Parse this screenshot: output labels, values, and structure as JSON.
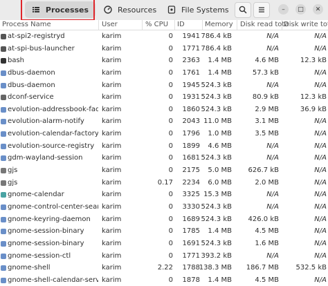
{
  "tabs": [
    {
      "label": "Processes",
      "icon": "list-icon"
    },
    {
      "label": "Resources",
      "icon": "gauge-icon"
    },
    {
      "label": "File Systems",
      "icon": "disk-icon"
    }
  ],
  "header_buttons": {
    "search_icon": "search-icon",
    "menu_icon": "hamburger-menu-icon"
  },
  "window_controls": {
    "minimize": "–",
    "maximize": "□",
    "close": "✕"
  },
  "columns": {
    "name": "Process Name",
    "user": "User",
    "cpu": "% CPU",
    "id": "ID",
    "memory": "Memory",
    "disk_read": "Disk read tota",
    "disk_write": "Disk write tot"
  },
  "rows": [
    {
      "name": "at-spi2-registryd",
      "user": "karim",
      "cpu": "0",
      "id": "1941",
      "memory": "786.4 kB",
      "disk_read": "N/A",
      "disk_write": "N/A",
      "icon_color": "#555555"
    },
    {
      "name": "at-spi-bus-launcher",
      "user": "karim",
      "cpu": "0",
      "id": "1771",
      "memory": "786.4 kB",
      "disk_read": "N/A",
      "disk_write": "N/A",
      "icon_color": "#555555"
    },
    {
      "name": "bash",
      "user": "karim",
      "cpu": "0",
      "id": "2363",
      "memory": "1.4 MB",
      "disk_read": "4.6 MB",
      "disk_write": "12.3 kB",
      "icon_color": "#333333"
    },
    {
      "name": "dbus-daemon",
      "user": "karim",
      "cpu": "0",
      "id": "1761",
      "memory": "1.4 MB",
      "disk_read": "57.3 kB",
      "disk_write": "N/A",
      "icon_color": "#6a8fc8"
    },
    {
      "name": "dbus-daemon",
      "user": "karim",
      "cpu": "0",
      "id": "1945",
      "memory": "524.3 kB",
      "disk_read": "N/A",
      "disk_write": "N/A",
      "icon_color": "#6a8fc8"
    },
    {
      "name": "dconf-service",
      "user": "karim",
      "cpu": "0",
      "id": "1931",
      "memory": "524.3 kB",
      "disk_read": "80.9 kB",
      "disk_write": "12.3 kB",
      "icon_color": "#666666"
    },
    {
      "name": "evolution-addressbook-factory",
      "user": "karim",
      "cpu": "0",
      "id": "1860",
      "memory": "524.3 kB",
      "disk_read": "2.9 MB",
      "disk_write": "36.9 kB",
      "icon_color": "#6a8fc8"
    },
    {
      "name": "evolution-alarm-notify",
      "user": "karim",
      "cpu": "0",
      "id": "2043",
      "memory": "11.0 MB",
      "disk_read": "3.1 MB",
      "disk_write": "N/A",
      "icon_color": "#6a8fc8"
    },
    {
      "name": "evolution-calendar-factory",
      "user": "karim",
      "cpu": "0",
      "id": "1796",
      "memory": "1.0 MB",
      "disk_read": "3.5 MB",
      "disk_write": "N/A",
      "icon_color": "#6a8fc8"
    },
    {
      "name": "evolution-source-registry",
      "user": "karim",
      "cpu": "0",
      "id": "1899",
      "memory": "4.6 MB",
      "disk_read": "N/A",
      "disk_write": "N/A",
      "icon_color": "#6a8fc8"
    },
    {
      "name": "gdm-wayland-session",
      "user": "karim",
      "cpu": "0",
      "id": "1681",
      "memory": "524.3 kB",
      "disk_read": "N/A",
      "disk_write": "N/A",
      "icon_color": "#6a8fc8"
    },
    {
      "name": "gjs",
      "user": "karim",
      "cpu": "0",
      "id": "2175",
      "memory": "5.0 MB",
      "disk_read": "626.7 kB",
      "disk_write": "N/A",
      "icon_color": "#777777"
    },
    {
      "name": "gjs",
      "user": "karim",
      "cpu": "0.17",
      "id": "2234",
      "memory": "6.0 MB",
      "disk_read": "2.0 MB",
      "disk_write": "N/A",
      "icon_color": "#777777"
    },
    {
      "name": "gnome-calendar",
      "user": "karim",
      "cpu": "0",
      "id": "3325",
      "memory": "15.3 MB",
      "disk_read": "N/A",
      "disk_write": "N/A",
      "icon_color": "#4aa3a3"
    },
    {
      "name": "gnome-control-center-search-p",
      "user": "karim",
      "cpu": "0",
      "id": "3330",
      "memory": "524.3 kB",
      "disk_read": "N/A",
      "disk_write": "N/A",
      "icon_color": "#6a8fc8"
    },
    {
      "name": "gnome-keyring-daemon",
      "user": "karim",
      "cpu": "0",
      "id": "1689",
      "memory": "524.3 kB",
      "disk_read": "426.0 kB",
      "disk_write": "N/A",
      "icon_color": "#6a8fc8"
    },
    {
      "name": "gnome-session-binary",
      "user": "karim",
      "cpu": "0",
      "id": "1785",
      "memory": "1.4 MB",
      "disk_read": "4.5 MB",
      "disk_write": "N/A",
      "icon_color": "#6a8fc8"
    },
    {
      "name": "gnome-session-binary",
      "user": "karim",
      "cpu": "0",
      "id": "1691",
      "memory": "524.3 kB",
      "disk_read": "1.6 MB",
      "disk_write": "N/A",
      "icon_color": "#6a8fc8"
    },
    {
      "name": "gnome-session-ctl",
      "user": "karim",
      "cpu": "0",
      "id": "1771",
      "memory": "393.2 kB",
      "disk_read": "N/A",
      "disk_write": "N/A",
      "icon_color": "#6a8fc8"
    },
    {
      "name": "gnome-shell",
      "user": "karim",
      "cpu": "2.22",
      "id": "1788",
      "memory": "138.3 MB",
      "disk_read": "186.7 MB",
      "disk_write": "532.5 kB",
      "icon_color": "#6a8fc8"
    },
    {
      "name": "gnome-shell-calendar-server",
      "user": "karim",
      "cpu": "0",
      "id": "1878",
      "memory": "1.4 MB",
      "disk_read": "4.5 MB",
      "disk_write": "N/A",
      "icon_color": "#6a8fc8"
    }
  ]
}
